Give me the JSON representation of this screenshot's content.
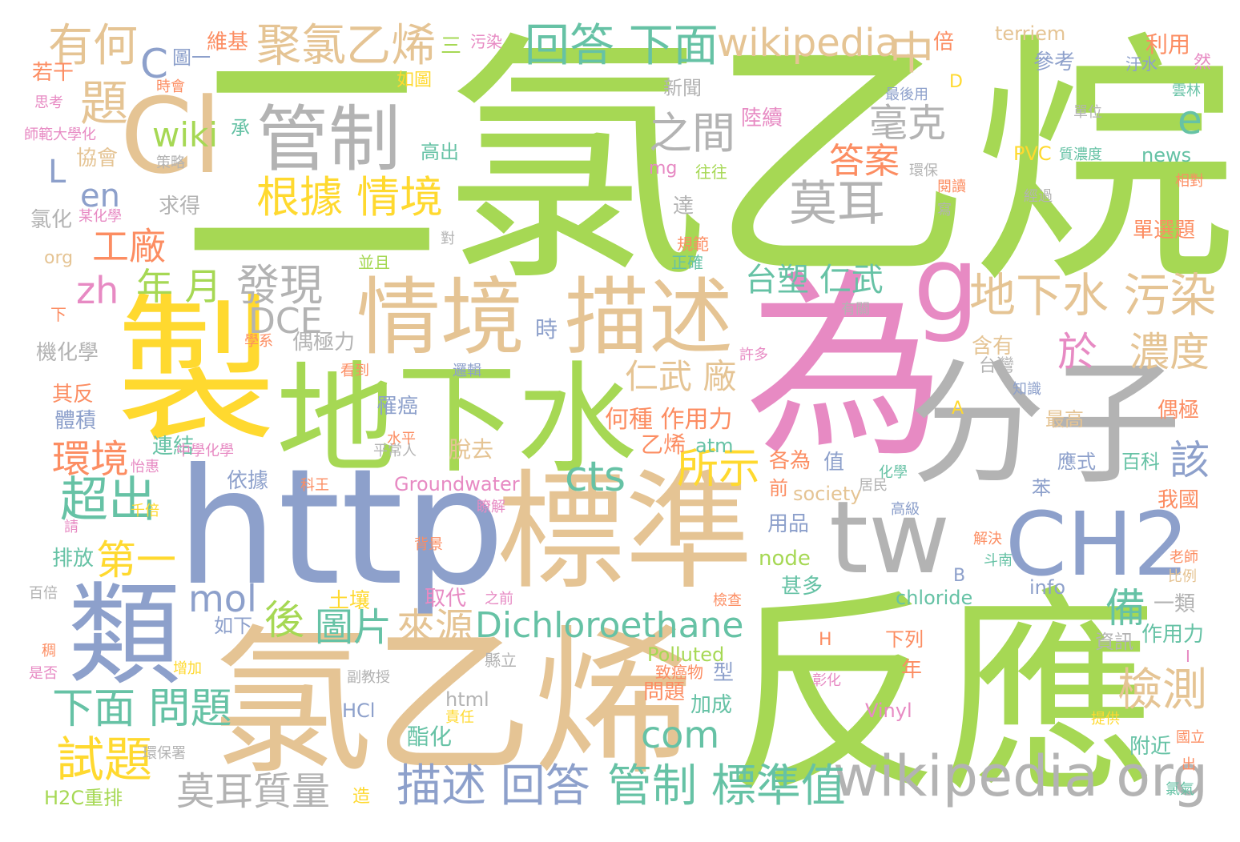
{
  "palette": {
    "green": "#a6d854",
    "blue": "#8da0cb",
    "tan": "#e5c494",
    "grey": "#b3b3b3",
    "pink": "#e78ac3",
    "yellow": "#ffd92f",
    "teal": "#66c2a5",
    "orange": "#fc8d62"
  },
  "words": [
    {
      "text": "二氯乙烷",
      "color": "green",
      "weight": 1.0
    },
    {
      "text": "反應",
      "color": "green",
      "weight": 0.75
    },
    {
      "text": "氯乙烯",
      "color": "tan",
      "weight": 0.72
    },
    {
      "text": "為",
      "color": "pink",
      "weight": 0.7
    },
    {
      "text": "http",
      "color": "blue",
      "weight": 0.62
    },
    {
      "text": "製",
      "color": "yellow",
      "weight": 0.6
    },
    {
      "text": "地下水",
      "color": "green",
      "weight": 0.55
    },
    {
      "text": "分子",
      "color": "grey",
      "weight": 0.5
    },
    {
      "text": "標準",
      "color": "tan",
      "weight": 0.5
    },
    {
      "text": "類",
      "color": "blue",
      "weight": 0.48
    },
    {
      "text": "情境",
      "color": "tan",
      "weight": 0.42
    },
    {
      "text": "描述",
      "color": "tan",
      "weight": 0.42
    },
    {
      "text": "Cl",
      "color": "tan",
      "weight": 0.4
    },
    {
      "text": "g",
      "color": "pink",
      "weight": 0.4
    },
    {
      "text": "tw",
      "color": "grey",
      "weight": 0.38
    },
    {
      "text": "CH2",
      "color": "blue",
      "weight": 0.34
    },
    {
      "text": "管制",
      "color": "grey",
      "weight": 0.3
    },
    {
      "text": "wikipedia org",
      "color": "grey",
      "weight": 0.22
    },
    {
      "text": "地下水 污染",
      "color": "tan",
      "weight": 0.17
    },
    {
      "text": "聚氯乙烯",
      "color": "tan",
      "weight": 0.15
    },
    {
      "text": "回答 下面",
      "color": "teal",
      "weight": 0.15
    },
    {
      "text": "wikipedia",
      "color": "tan",
      "weight": 0.13
    },
    {
      "text": "中",
      "color": "tan",
      "weight": 0.15
    },
    {
      "text": "有何",
      "color": "tan",
      "weight": 0.14
    },
    {
      "text": "C",
      "color": "blue",
      "weight": 0.14
    },
    {
      "text": "題",
      "color": "tan",
      "weight": 0.15
    },
    {
      "text": "之間",
      "color": "grey",
      "weight": 0.14
    },
    {
      "text": "毫克",
      "color": "grey",
      "weight": 0.13
    },
    {
      "text": "e",
      "color": "teal",
      "weight": 0.14
    },
    {
      "text": "根據 情境",
      "color": "yellow",
      "weight": 0.14
    },
    {
      "text": "莫耳",
      "color": "grey",
      "weight": 0.15
    },
    {
      "text": "答案",
      "color": "orange",
      "weight": 0.12
    },
    {
      "text": "wiki",
      "color": "green",
      "weight": 0.12
    },
    {
      "text": "en",
      "color": "blue",
      "weight": 0.11
    },
    {
      "text": "L",
      "color": "blue",
      "weight": 0.11
    },
    {
      "text": "工廠",
      "color": "orange",
      "weight": 0.12
    },
    {
      "text": "zh",
      "color": "pink",
      "weight": 0.12
    },
    {
      "text": "年 月",
      "color": "green",
      "weight": 0.12
    },
    {
      "text": "發現",
      "color": "grey",
      "weight": 0.14
    },
    {
      "text": "台塑 仁武",
      "color": "teal",
      "weight": 0.1
    },
    {
      "text": "DCE",
      "color": "grey",
      "weight": 0.12
    },
    {
      "text": "於",
      "color": "pink",
      "weight": 0.13
    },
    {
      "text": "濃度",
      "color": "tan",
      "weight": 0.13
    },
    {
      "text": "仁武 廠",
      "color": "tan",
      "weight": 0.11
    },
    {
      "text": "環境",
      "color": "orange",
      "weight": 0.12
    },
    {
      "text": "超出",
      "color": "teal",
      "weight": 0.15
    },
    {
      "text": "cts",
      "color": "teal",
      "weight": 0.13
    },
    {
      "text": "所示",
      "color": "yellow",
      "weight": 0.13
    },
    {
      "text": "第一",
      "color": "yellow",
      "weight": 0.12
    },
    {
      "text": "mol",
      "color": "blue",
      "weight": 0.12
    },
    {
      "text": "後",
      "color": "green",
      "weight": 0.12
    },
    {
      "text": "圖片",
      "color": "teal",
      "weight": 0.12
    },
    {
      "text": "來源",
      "color": "tan",
      "weight": 0.12
    },
    {
      "text": "Dichloroethane",
      "color": "teal",
      "weight": 0.12
    },
    {
      "text": "下面 問題",
      "color": "teal",
      "weight": 0.14
    },
    {
      "text": "試題",
      "color": "yellow",
      "weight": 0.14
    },
    {
      "text": "莫耳質量",
      "color": "grey",
      "weight": 0.11
    },
    {
      "text": "com",
      "color": "teal",
      "weight": 0.11
    },
    {
      "text": "描述 回答",
      "color": "blue",
      "weight": 0.14
    },
    {
      "text": "管制 標準值",
      "color": "teal",
      "weight": 0.14
    },
    {
      "text": "檢測",
      "color": "tan",
      "weight": 0.13
    },
    {
      "text": "備",
      "color": "teal",
      "weight": 0.12
    },
    {
      "text": "該",
      "color": "blue",
      "weight": 0.12
    },
    {
      "text": "何種 作用力",
      "color": "orange",
      "weight": 0.09
    },
    {
      "text": "乙烯",
      "color": "orange",
      "weight": 0.08
    },
    {
      "text": "偶極力",
      "color": "grey",
      "weight": 0.06
    },
    {
      "text": "含有",
      "color": "tan",
      "weight": 0.07
    },
    {
      "text": "台灣",
      "color": "grey",
      "weight": 0.06
    },
    {
      "text": "最高",
      "color": "tan",
      "weight": 0.06
    },
    {
      "text": "偶極",
      "color": "orange",
      "weight": 0.07
    },
    {
      "text": "應式",
      "color": "blue",
      "weight": 0.06
    },
    {
      "text": "百科",
      "color": "teal",
      "weight": 0.06
    },
    {
      "text": "Groundwater",
      "color": "pink",
      "weight": 0.07
    },
    {
      "text": "society",
      "color": "tan",
      "weight": 0.07
    },
    {
      "text": "atm",
      "color": "teal",
      "weight": 0.07
    },
    {
      "text": "node",
      "color": "green",
      "weight": 0.07
    },
    {
      "text": "chloride",
      "color": "teal",
      "weight": 0.07
    },
    {
      "text": "info",
      "color": "blue",
      "weight": 0.07
    },
    {
      "text": "Polluted",
      "color": "green",
      "weight": 0.07
    },
    {
      "text": "Vinyl",
      "color": "pink",
      "weight": 0.07
    },
    {
      "text": "HCl",
      "color": "blue",
      "weight": 0.06
    },
    {
      "text": "html",
      "color": "grey",
      "weight": 0.06
    },
    {
      "text": "H2C重排",
      "color": "green",
      "weight": 0.06
    },
    {
      "text": "terriem",
      "color": "tan",
      "weight": 0.06
    },
    {
      "text": "news",
      "color": "teal",
      "weight": 0.06
    },
    {
      "text": "PVC",
      "color": "yellow",
      "weight": 0.06
    },
    {
      "text": "mg",
      "color": "pink",
      "weight": 0.06
    },
    {
      "text": "org",
      "color": "tan",
      "weight": 0.06
    },
    {
      "text": "D",
      "color": "yellow",
      "weight": 0.06
    },
    {
      "text": "A",
      "color": "yellow",
      "weight": 0.06
    },
    {
      "text": "B",
      "color": "blue",
      "weight": 0.06
    },
    {
      "text": "H",
      "color": "orange",
      "weight": 0.06
    },
    {
      "text": "I",
      "color": "pink",
      "weight": 0.05
    },
    {
      "text": "維基",
      "color": "orange",
      "weight": 0.06
    },
    {
      "text": "圖一",
      "color": "blue",
      "weight": 0.06
    },
    {
      "text": "三",
      "color": "green",
      "weight": 0.06
    },
    {
      "text": "污染",
      "color": "pink",
      "weight": 0.05
    },
    {
      "text": "倍",
      "color": "orange",
      "weight": 0.06
    },
    {
      "text": "利用",
      "color": "orange",
      "weight": 0.06
    },
    {
      "text": "參考",
      "color": "blue",
      "weight": 0.06
    },
    {
      "text": "汙水",
      "color": "blue",
      "weight": 0.05
    },
    {
      "text": "然",
      "color": "pink",
      "weight": 0.05
    },
    {
      "text": "雲林",
      "color": "teal",
      "weight": 0.05
    },
    {
      "text": "若干",
      "color": "orange",
      "weight": 0.05
    },
    {
      "text": "如圖",
      "color": "yellow",
      "weight": 0.05
    },
    {
      "text": "時會",
      "color": "orange",
      "weight": 0.05
    },
    {
      "text": "思考",
      "color": "pink",
      "weight": 0.05
    },
    {
      "text": "師範大學化",
      "color": "pink",
      "weight": 0.05
    },
    {
      "text": "承",
      "color": "teal",
      "weight": 0.05
    },
    {
      "text": "新聞",
      "color": "grey",
      "weight": 0.05
    },
    {
      "text": "陸續",
      "color": "pink",
      "weight": 0.06
    },
    {
      "text": "最後用",
      "color": "blue",
      "weight": 0.05
    },
    {
      "text": "單位",
      "color": "grey",
      "weight": 0.05
    },
    {
      "text": "協會",
      "color": "tan",
      "weight": 0.06
    },
    {
      "text": "策略",
      "color": "grey",
      "weight": 0.05
    },
    {
      "text": "高出",
      "color": "teal",
      "weight": 0.06
    },
    {
      "text": "質濃度",
      "color": "teal",
      "weight": 0.05
    },
    {
      "text": "環保",
      "color": "grey",
      "weight": 0.05
    },
    {
      "text": "閱讀",
      "color": "orange",
      "weight": 0.05
    },
    {
      "text": "經過",
      "color": "grey",
      "weight": 0.05
    },
    {
      "text": "相對",
      "color": "orange",
      "weight": 0.05
    },
    {
      "text": "往往",
      "color": "green",
      "weight": 0.05
    },
    {
      "text": "求得",
      "color": "grey",
      "weight": 0.06
    },
    {
      "text": "氯化",
      "color": "grey",
      "weight": 0.06
    },
    {
      "text": "某化學",
      "color": "pink",
      "weight": 0.05
    },
    {
      "text": "達",
      "color": "grey",
      "weight": 0.06
    },
    {
      "text": "寫",
      "color": "grey",
      "weight": 0.05
    },
    {
      "text": "單選題",
      "color": "orange",
      "weight": 0.06
    },
    {
      "text": "對",
      "color": "grey",
      "weight": 0.05
    },
    {
      "text": "規範",
      "color": "orange",
      "weight": 0.05
    },
    {
      "text": "正確",
      "color": "teal",
      "weight": 0.05
    },
    {
      "text": "並且",
      "color": "green",
      "weight": 0.05
    },
    {
      "text": "下",
      "color": "orange",
      "weight": 0.05
    },
    {
      "text": "時",
      "color": "blue",
      "weight": 0.06
    },
    {
      "text": "有關",
      "color": "grey",
      "weight": 0.05
    },
    {
      "text": "機化學",
      "color": "grey",
      "weight": 0.06
    },
    {
      "text": "學系",
      "color": "orange",
      "weight": 0.05
    },
    {
      "text": "許多",
      "color": "pink",
      "weight": 0.05
    },
    {
      "text": "看到",
      "color": "orange",
      "weight": 0.05
    },
    {
      "text": "知識",
      "color": "blue",
      "weight": 0.05
    },
    {
      "text": "其反",
      "color": "orange",
      "weight": 0.06
    },
    {
      "text": "體積",
      "color": "blue",
      "weight": 0.06
    },
    {
      "text": "邏輯",
      "color": "blue",
      "weight": 0.05
    },
    {
      "text": "罹癌",
      "color": "blue",
      "weight": 0.06
    },
    {
      "text": "水平",
      "color": "orange",
      "weight": 0.05
    },
    {
      "text": "連結",
      "color": "teal",
      "weight": 0.06
    },
    {
      "text": "中學化學",
      "color": "pink",
      "weight": 0.05
    },
    {
      "text": "平常人",
      "color": "grey",
      "weight": 0.05
    },
    {
      "text": "脫去",
      "color": "tan",
      "weight": 0.06
    },
    {
      "text": "各為",
      "color": "orange",
      "weight": 0.06
    },
    {
      "text": "值",
      "color": "blue",
      "weight": 0.06
    },
    {
      "text": "怡惠",
      "color": "pink",
      "weight": 0.05
    },
    {
      "text": "依據",
      "color": "blue",
      "weight": 0.06
    },
    {
      "text": "科王",
      "color": "orange",
      "weight": 0.05
    },
    {
      "text": "居民",
      "color": "grey",
      "weight": 0.05
    },
    {
      "text": "化學",
      "color": "teal",
      "weight": 0.05
    },
    {
      "text": "苯",
      "color": "blue",
      "weight": 0.06
    },
    {
      "text": "我國",
      "color": "orange",
      "weight": 0.06
    },
    {
      "text": "前",
      "color": "orange",
      "weight": 0.06
    },
    {
      "text": "瞭解",
      "color": "pink",
      "weight": 0.05
    },
    {
      "text": "高級",
      "color": "blue",
      "weight": 0.05
    },
    {
      "text": "千倍",
      "color": "yellow",
      "weight": 0.05
    },
    {
      "text": "請",
      "color": "pink",
      "weight": 0.05
    },
    {
      "text": "背景",
      "color": "orange",
      "weight": 0.05
    },
    {
      "text": "用品",
      "color": "blue",
      "weight": 0.06
    },
    {
      "text": "解決",
      "color": "orange",
      "weight": 0.05
    },
    {
      "text": "斗南",
      "color": "teal",
      "weight": 0.05
    },
    {
      "text": "老師",
      "color": "orange",
      "weight": 0.05
    },
    {
      "text": "排放",
      "color": "teal",
      "weight": 0.06
    },
    {
      "text": "比例",
      "color": "tan",
      "weight": 0.05
    },
    {
      "text": "甚多",
      "color": "teal",
      "weight": 0.06
    },
    {
      "text": "百倍",
      "color": "grey",
      "weight": 0.05
    },
    {
      "text": "土壤",
      "color": "yellow",
      "weight": 0.06
    },
    {
      "text": "取代",
      "color": "pink",
      "weight": 0.06
    },
    {
      "text": "之前",
      "color": "pink",
      "weight": 0.05
    },
    {
      "text": "檢查",
      "color": "orange",
      "weight": 0.05
    },
    {
      "text": "一類",
      "color": "grey",
      "weight": 0.06
    },
    {
      "text": "如下",
      "color": "blue",
      "weight": 0.06
    },
    {
      "text": "下列",
      "color": "orange",
      "weight": 0.06
    },
    {
      "text": "資訊",
      "color": "grey",
      "weight": 0.06
    },
    {
      "text": "作用力",
      "color": "teal",
      "weight": 0.06
    },
    {
      "text": "稠",
      "color": "orange",
      "weight": 0.05
    },
    {
      "text": "是否",
      "color": "pink",
      "weight": 0.05
    },
    {
      "text": "增加",
      "color": "yellow",
      "weight": 0.05
    },
    {
      "text": "縣立",
      "color": "grey",
      "weight": 0.05
    },
    {
      "text": "致癌物",
      "color": "orange",
      "weight": 0.05
    },
    {
      "text": "型",
      "color": "blue",
      "weight": 0.06
    },
    {
      "text": "年",
      "color": "orange",
      "weight": 0.06
    },
    {
      "text": "問題",
      "color": "orange",
      "weight": 0.06
    },
    {
      "text": "副教授",
      "color": "grey",
      "weight": 0.05
    },
    {
      "text": "加成",
      "color": "teal",
      "weight": 0.06
    },
    {
      "text": "彰化",
      "color": "pink",
      "weight": 0.05
    },
    {
      "text": "責任",
      "color": "yellow",
      "weight": 0.05
    },
    {
      "text": "酯化",
      "color": "teal",
      "weight": 0.06
    },
    {
      "text": "提供",
      "color": "yellow",
      "weight": 0.05
    },
    {
      "text": "國立",
      "color": "orange",
      "weight": 0.05
    },
    {
      "text": "環保署",
      "color": "grey",
      "weight": 0.05
    },
    {
      "text": "附近",
      "color": "teal",
      "weight": 0.06
    },
    {
      "text": "出",
      "color": "orange",
      "weight": 0.05
    },
    {
      "text": "造",
      "color": "yellow",
      "weight": 0.05
    },
    {
      "text": "氯氣",
      "color": "teal",
      "weight": 0.05
    }
  ]
}
